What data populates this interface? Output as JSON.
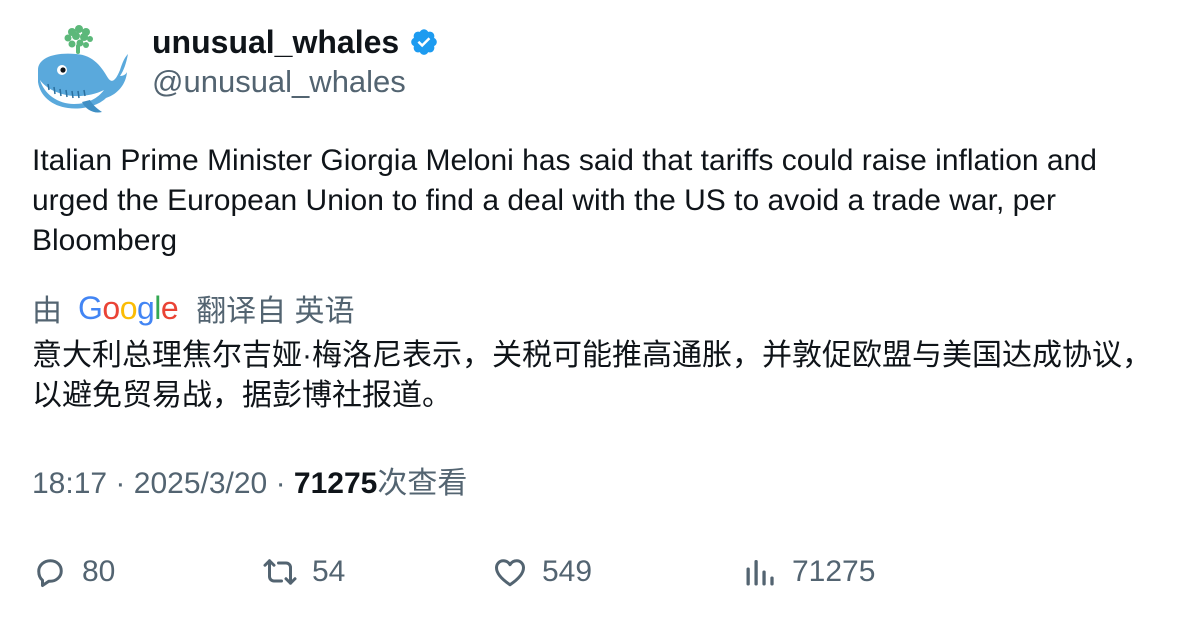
{
  "author": {
    "display_name": "unusual_whales",
    "handle": "@unusual_whales",
    "verified": true,
    "avatar_icon": "whale-logo-icon"
  },
  "tweet": {
    "text": "Italian Prime Minister Giorgia Meloni has said that tariffs could raise inflation and urged the European Union to find a deal with the US to avoid a trade war, per Bloomberg"
  },
  "translation": {
    "prefix": "由",
    "provider": "Google",
    "suffix": "翻译自 英语",
    "text": "意大利总理焦尔吉娅·梅洛尼表示，关税可能推高通胀，并敦促欧盟与美国达成协议，以避免贸易战，据彭博社报道。"
  },
  "meta": {
    "time": "18:17",
    "separator": "·",
    "date": "2025/3/20",
    "views_count": "71275",
    "views_label": "次查看"
  },
  "actions": {
    "replies": "80",
    "retweets": "54",
    "likes": "549",
    "views": "71275"
  },
  "colors": {
    "text_primary": "#0f1419",
    "text_secondary": "#536471",
    "verified_blue": "#1d9bf0",
    "google_blue": "#4285f4",
    "google_red": "#ea4335",
    "google_yellow": "#fbbc05",
    "google_green": "#34a853"
  }
}
